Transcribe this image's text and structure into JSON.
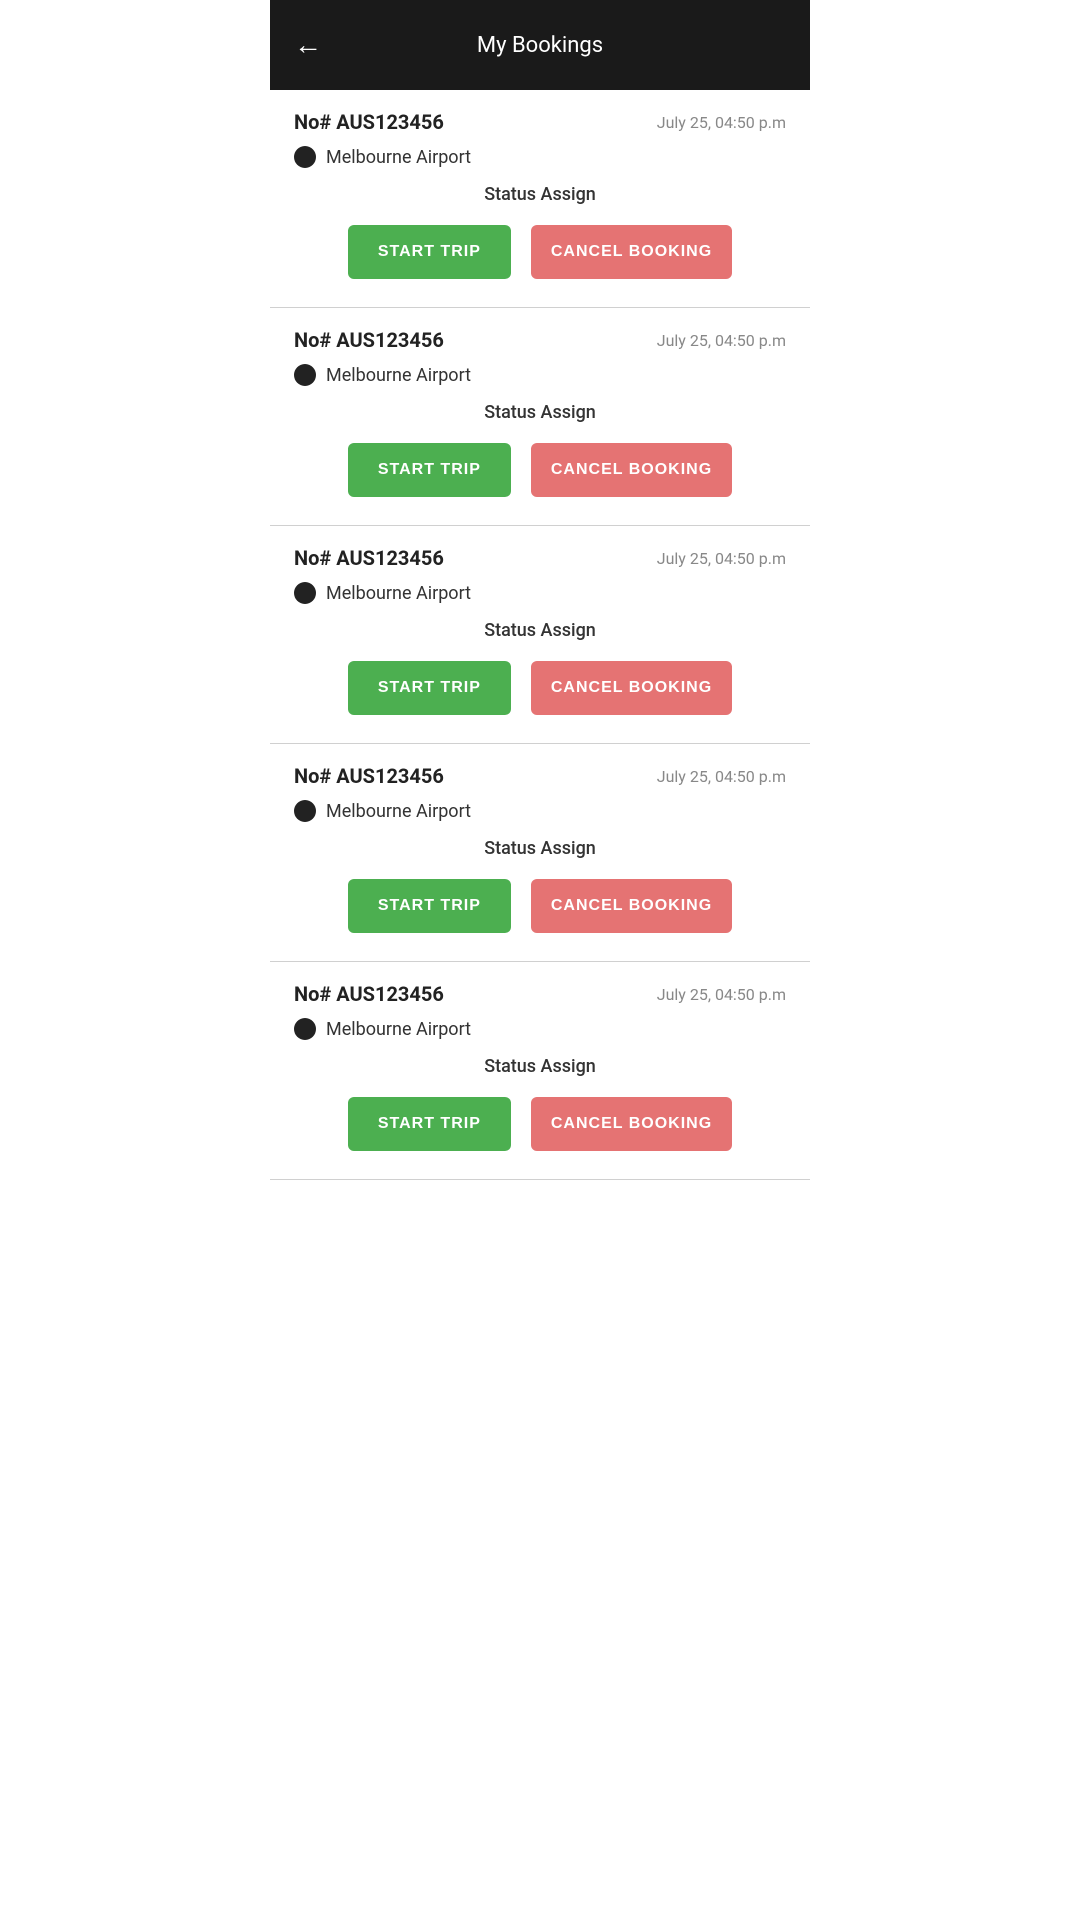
{
  "header": {
    "title": "My Bookings",
    "back_icon": "←"
  },
  "bookings": [
    {
      "id": "booking-1",
      "number_label": "No# AUS123456",
      "date": "July 25, 04:50 p.m",
      "location": "Melbourne Airport",
      "status": "Status Assign",
      "start_trip_label": "START TRIP",
      "cancel_label": "CANCEL BOOKING"
    },
    {
      "id": "booking-2",
      "number_label": "No# AUS123456",
      "date": "July 25, 04:50 p.m",
      "location": "Melbourne Airport",
      "status": "Status Assign",
      "start_trip_label": "START TRIP",
      "cancel_label": "CANCEL BOOKING"
    },
    {
      "id": "booking-3",
      "number_label": "No# AUS123456",
      "date": "July 25, 04:50 p.m",
      "location": "Melbourne Airport",
      "status": "Status Assign",
      "start_trip_label": "START TRIP",
      "cancel_label": "CANCEL BOOKING"
    },
    {
      "id": "booking-4",
      "number_label": "No# AUS123456",
      "date": "July 25, 04:50 p.m",
      "location": "Melbourne Airport",
      "status": "Status Assign",
      "start_trip_label": "START TRIP",
      "cancel_label": "CANCEL BOOKING"
    },
    {
      "id": "booking-5",
      "number_label": "No# AUS123456",
      "date": "July 25, 04:50 p.m",
      "location": "Melbourne Airport",
      "status": "Status Assign",
      "start_trip_label": "START TRIP",
      "cancel_label": "CANCEL BOOKING"
    }
  ],
  "colors": {
    "header_bg": "#1a1a1a",
    "start_trip_bg": "#4caf50",
    "cancel_bg": "#e57373",
    "dot_color": "#222222"
  }
}
